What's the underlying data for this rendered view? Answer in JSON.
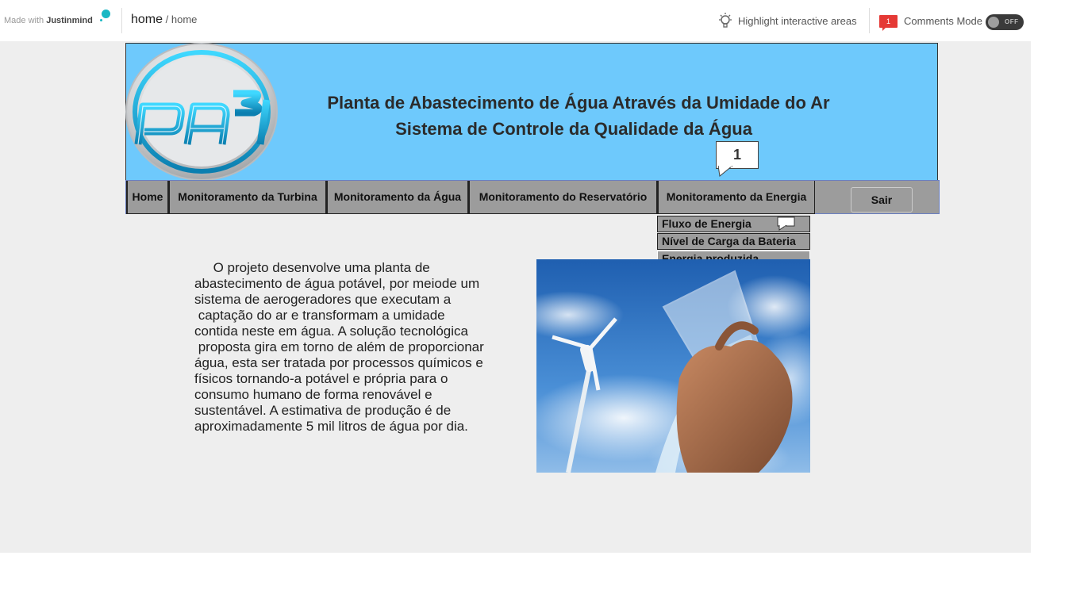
{
  "topbar": {
    "made_with_prefix": "Made with ",
    "made_with_brand": "Justinmind",
    "breadcrumb_main": "home",
    "breadcrumb_sep": " / ",
    "breadcrumb_sub": "home",
    "highlight_label": "Highlight interactive areas",
    "comments_count": "1",
    "comments_label": "Comments Mode",
    "toggle_state": "OFF"
  },
  "header": {
    "logo_text": "PA³I",
    "title_line1": "Planta de Abastecimento de Água Através da Umidade do Ar",
    "title_line2": "Sistema de Controle da Qualidade da Água",
    "comment_marker": "1"
  },
  "nav": {
    "items": [
      {
        "label": "Home"
      },
      {
        "label": "Monitoramento da Turbina"
      },
      {
        "label": "Monitoramento da Água"
      },
      {
        "label": "Monitoramento do Reservatório"
      },
      {
        "label": "Monitoramento da Energia"
      }
    ],
    "logout_label": "Sair"
  },
  "dropdown": {
    "items": [
      {
        "label": "Fluxo de Energia"
      },
      {
        "label": "Nível de Carga da Bateria"
      },
      {
        "label": "Energia produzida"
      }
    ]
  },
  "content": {
    "paragraph": "     O projeto desenvolve uma planta de\nabastecimento de água potável, por meiode um\nsistema de aerogeradores que executam a\n captação do ar e transformam a umidade\ncontida neste em água. A solução tecnológica\n proposta gira em torno de além de proporcionar\nágua, esta ser tratada por processos químicos e\nfísicos tornando-a potável e própria para o\nconsumo humano de forma renovável e\nsustentável. A estimativa de produção é de\naproximadamente 5 mil litros de água por dia."
  },
  "colors": {
    "header_bg": "#6ec9fc",
    "nav_bg": "#9c9c9c",
    "canvas_bg": "#eeeeee",
    "accent_teal": "#19b8c4",
    "badge_red": "#e53935"
  }
}
